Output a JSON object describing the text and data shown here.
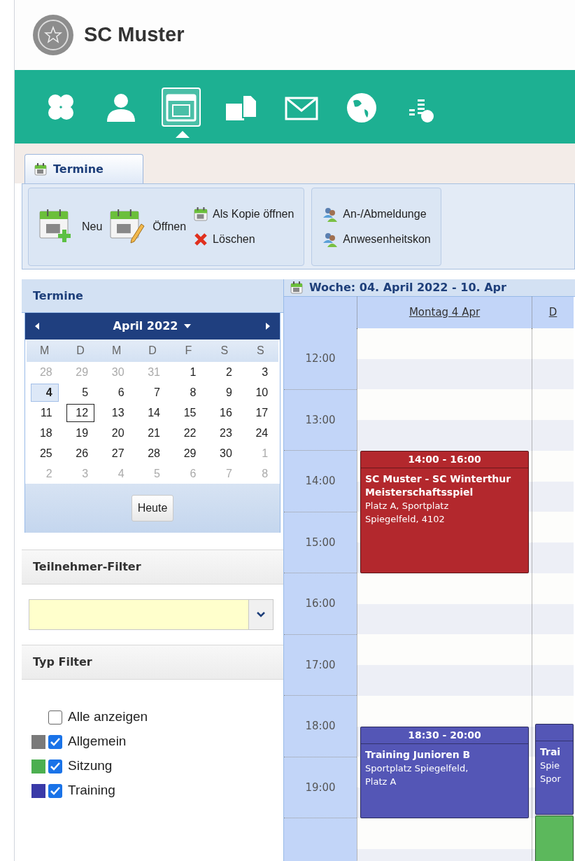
{
  "header": {
    "title": "SC Muster"
  },
  "nav": [
    {
      "kind": "clover",
      "selected": false
    },
    {
      "kind": "person",
      "selected": false
    },
    {
      "kind": "calendar",
      "selected": true
    },
    {
      "kind": "documents",
      "selected": false
    },
    {
      "kind": "mail",
      "selected": false
    },
    {
      "kind": "globe",
      "selected": false
    },
    {
      "kind": "finance",
      "selected": false
    }
  ],
  "tabs": [
    {
      "label": "Termine",
      "selected": true
    }
  ],
  "toolbar": {
    "groups": [
      {
        "items": [
          {
            "kind": "new",
            "label": "Neu"
          },
          {
            "kind": "open",
            "label": "Öffnen"
          },
          {
            "kind": "copy",
            "label": "Als Kopie öffnen"
          },
          {
            "kind": "delete",
            "label": "Löschen"
          }
        ]
      },
      {
        "items": [
          {
            "kind": "people",
            "label": "An-/Abmeldunge"
          },
          {
            "kind": "people",
            "label": "Anwesenheitskon"
          }
        ]
      }
    ]
  },
  "sidebar": {
    "title": "Termine",
    "month": "April 2022",
    "weekdays": [
      "M",
      "D",
      "M",
      "D",
      "F",
      "S",
      "S"
    ],
    "weeks": [
      [
        {
          "day": "28",
          "other_month": true,
          "selected": false,
          "today": false
        },
        {
          "day": "29",
          "other_month": true,
          "selected": false,
          "today": false
        },
        {
          "day": "30",
          "other_month": true,
          "selected": false,
          "today": false
        },
        {
          "day": "31",
          "other_month": true,
          "selected": false,
          "today": false
        },
        {
          "day": "1",
          "other_month": false,
          "selected": false,
          "today": false
        },
        {
          "day": "2",
          "other_month": false,
          "selected": false,
          "today": false
        },
        {
          "day": "3",
          "other_month": false,
          "selected": false,
          "today": false
        }
      ],
      [
        {
          "day": "4",
          "other_month": false,
          "selected": true,
          "today": false
        },
        {
          "day": "5",
          "other_month": false,
          "selected": false,
          "today": false
        },
        {
          "day": "6",
          "other_month": false,
          "selected": false,
          "today": false
        },
        {
          "day": "7",
          "other_month": false,
          "selected": false,
          "today": false
        },
        {
          "day": "8",
          "other_month": false,
          "selected": false,
          "today": false
        },
        {
          "day": "9",
          "other_month": false,
          "selected": false,
          "today": false
        },
        {
          "day": "10",
          "other_month": false,
          "selected": false,
          "today": false
        }
      ],
      [
        {
          "day": "11",
          "other_month": false,
          "selected": false,
          "today": false
        },
        {
          "day": "12",
          "other_month": false,
          "selected": false,
          "today": true
        },
        {
          "day": "13",
          "other_month": false,
          "selected": false,
          "today": false
        },
        {
          "day": "14",
          "other_month": false,
          "selected": false,
          "today": false
        },
        {
          "day": "15",
          "other_month": false,
          "selected": false,
          "today": false
        },
        {
          "day": "16",
          "other_month": false,
          "selected": false,
          "today": false
        },
        {
          "day": "17",
          "other_month": false,
          "selected": false,
          "today": false
        }
      ],
      [
        {
          "day": "18",
          "other_month": false,
          "selected": false,
          "today": false
        },
        {
          "day": "19",
          "other_month": false,
          "selected": false,
          "today": false
        },
        {
          "day": "20",
          "other_month": false,
          "selected": false,
          "today": false
        },
        {
          "day": "21",
          "other_month": false,
          "selected": false,
          "today": false
        },
        {
          "day": "22",
          "other_month": false,
          "selected": false,
          "today": false
        },
        {
          "day": "23",
          "other_month": false,
          "selected": false,
          "today": false
        },
        {
          "day": "24",
          "other_month": false,
          "selected": false,
          "today": false
        }
      ],
      [
        {
          "day": "25",
          "other_month": false,
          "selected": false,
          "today": false
        },
        {
          "day": "26",
          "other_month": false,
          "selected": false,
          "today": false
        },
        {
          "day": "27",
          "other_month": false,
          "selected": false,
          "today": false
        },
        {
          "day": "28",
          "other_month": false,
          "selected": false,
          "today": false
        },
        {
          "day": "29",
          "other_month": false,
          "selected": false,
          "today": false
        },
        {
          "day": "30",
          "other_month": false,
          "selected": false,
          "today": false
        },
        {
          "day": "1",
          "other_month": true,
          "selected": false,
          "today": false
        }
      ],
      [
        {
          "day": "2",
          "other_month": true,
          "selected": false,
          "today": false
        },
        {
          "day": "3",
          "other_month": true,
          "selected": false,
          "today": false
        },
        {
          "day": "4",
          "other_month": true,
          "selected": false,
          "today": false
        },
        {
          "day": "5",
          "other_month": true,
          "selected": false,
          "today": false
        },
        {
          "day": "6",
          "other_month": true,
          "selected": false,
          "today": false
        },
        {
          "day": "7",
          "other_month": true,
          "selected": false,
          "today": false
        },
        {
          "day": "8",
          "other_month": true,
          "selected": false,
          "today": false
        }
      ]
    ],
    "today_button": "Heute",
    "participant_filter": {
      "title": "Teilnehmer-Filter"
    },
    "type_filter": {
      "title": "Typ Filter",
      "items": [
        {
          "kind": "all",
          "label": "Alle anzeigen",
          "checked": false
        },
        {
          "kind": "type",
          "label": "Allgemein",
          "checked": true,
          "color": "#7a7a7a"
        },
        {
          "kind": "type",
          "label": "Sitzung",
          "checked": true,
          "color": "#4caf50"
        },
        {
          "kind": "type",
          "label": "Training",
          "checked": true,
          "color": "#3a3aa8"
        }
      ]
    }
  },
  "calendar": {
    "title": "Woche: 04. April 2022 - 10. Apr",
    "hours": [
      "12:00",
      "13:00",
      "14:00",
      "15:00",
      "16:00",
      "17:00",
      "18:00",
      "19:00"
    ],
    "days": [
      {
        "label": "Montag 4 Apr",
        "events": [
          {
            "time": "14:00 - 16:00",
            "title": "SC Muster - SC Winterthur Meisterschaftsspiel",
            "location": [
              "Platz A, Sportplatz",
              "Spiegelfeld, 4102"
            ],
            "color": "#b3282d"
          },
          {
            "time": "18:30 - 20:00",
            "title": "Training Junioren B",
            "location": [
              "Sportplatz Spiegelfeld,",
              "Platz A"
            ],
            "color": "#5456b6"
          }
        ]
      },
      {
        "label": "D",
        "events": [
          {
            "title": "Trai",
            "location": [
              "Spie",
              "Spor"
            ],
            "color": "#5456b6"
          },
          {
            "color": "#5cb85c"
          }
        ]
      }
    ]
  }
}
